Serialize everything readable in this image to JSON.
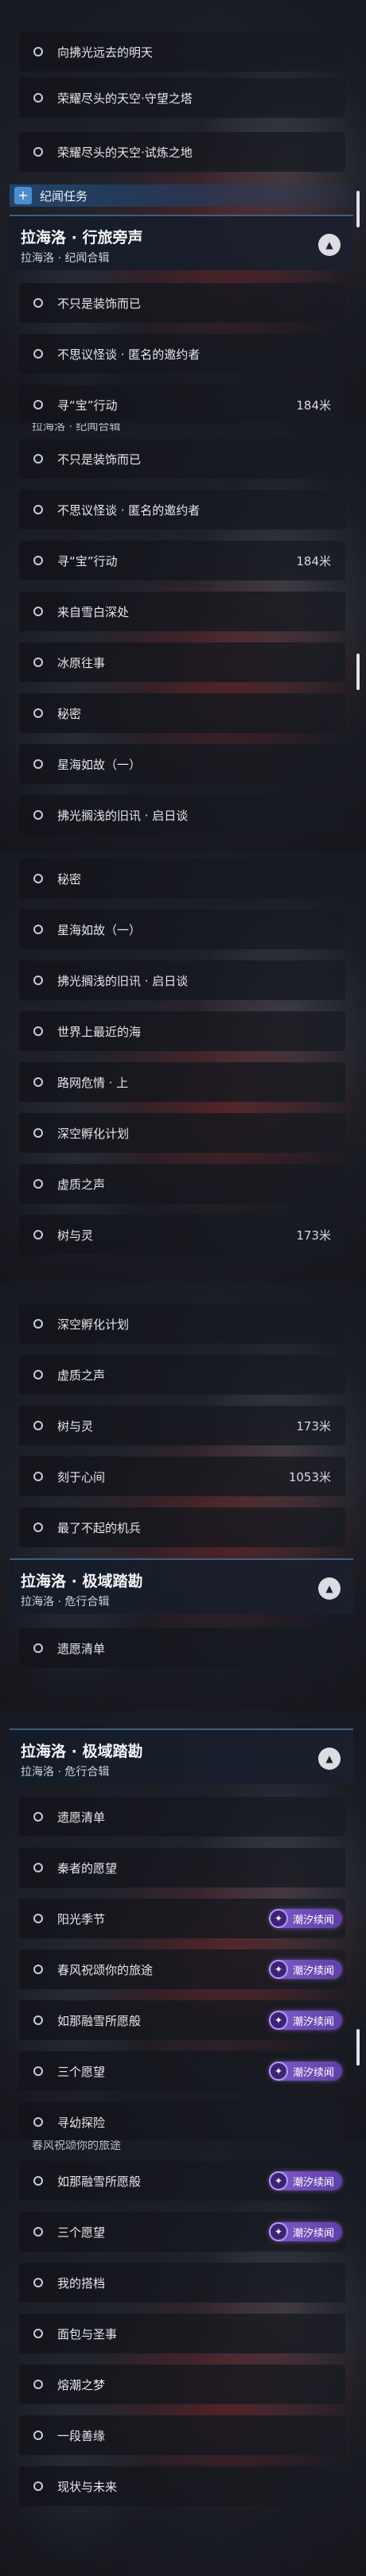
{
  "panel1": {
    "rows_top": [
      {
        "label": "向拂光远去的明天"
      },
      {
        "label": "荣耀尽头的天空·守望之塔"
      },
      {
        "label": "荣耀尽头的天空·试炼之地"
      }
    ],
    "category": {
      "label": "纪闻任务"
    },
    "header": {
      "title": "拉海洛 · 行旅旁声",
      "subtitle": "拉海洛 · 纪闻合辑"
    },
    "rows": [
      {
        "label": "不只是装饰而已"
      },
      {
        "label": "不思议怪谈 · 匿名的邀约者"
      },
      {
        "label": "寻“宝”行动",
        "distance": "184米"
      }
    ]
  },
  "panel2": {
    "ghost_header": "拉海洛 · 纪闻合辑",
    "rows": [
      {
        "label": "不只是装饰而已"
      },
      {
        "label": "不思议怪谈 · 匿名的邀约者"
      },
      {
        "label": "寻“宝”行动",
        "distance": "184米"
      },
      {
        "label": "来自雪白深处"
      },
      {
        "label": "冰原往事"
      },
      {
        "label": "秘密"
      },
      {
        "label": "星海如故（一）"
      },
      {
        "label": "拂光搁浅的旧讯 · 启日谈"
      }
    ]
  },
  "panel3": {
    "rows": [
      {
        "label": "秘密"
      },
      {
        "label": "星海如故（一）"
      },
      {
        "label": "拂光搁浅的旧讯 · 启日谈"
      },
      {
        "label": "世界上最近的海"
      },
      {
        "label": "路网危情 · 上"
      },
      {
        "label": "深空孵化计划"
      },
      {
        "label": "虚质之声"
      },
      {
        "label": "树与灵",
        "distance": "173米"
      }
    ]
  },
  "panel4": {
    "rows": [
      {
        "label": "深空孵化计划"
      },
      {
        "label": "虚质之声"
      },
      {
        "label": "树与灵",
        "distance": "173米"
      },
      {
        "label": "刻于心间",
        "distance": "1053米"
      },
      {
        "label": "最了不起的机兵"
      }
    ],
    "header": {
      "title": "拉海洛 · 极域踏勘",
      "subtitle": "拉海洛 · 危行合辑"
    },
    "rows_after": [
      {
        "label": "遗愿清单"
      }
    ]
  },
  "panel5": {
    "header": {
      "title": "拉海洛 · 极域踏勘",
      "subtitle": "拉海洛 · 危行合辑"
    },
    "badge_label": "潮汐续闻",
    "rows": [
      {
        "label": "遗愿清单"
      },
      {
        "label": "秦者的愿望"
      },
      {
        "label": "阳光季节",
        "badge": true
      },
      {
        "label": "春风祝颂你的旅途",
        "badge": true
      },
      {
        "label": "如那融雪所愿般",
        "badge": true
      },
      {
        "label": "三个愿望",
        "badge": true
      },
      {
        "label": "寻幼探险"
      }
    ]
  },
  "panel6": {
    "ghost_header": "春风祝颂你的旅途",
    "badge_label": "潮汐续闻",
    "rows": [
      {
        "label": "如那融雪所愿般",
        "badge": true
      },
      {
        "label": "三个愿望",
        "badge": true
      },
      {
        "label": "我的搭档"
      },
      {
        "label": "面包与圣事"
      },
      {
        "label": "熔潮之梦"
      },
      {
        "label": "一段善缘"
      },
      {
        "label": "现状与未来"
      }
    ]
  },
  "colors": {
    "badge": "#7d5cc8",
    "category": "#4b8ed0",
    "accent_line": "#78aadc"
  }
}
